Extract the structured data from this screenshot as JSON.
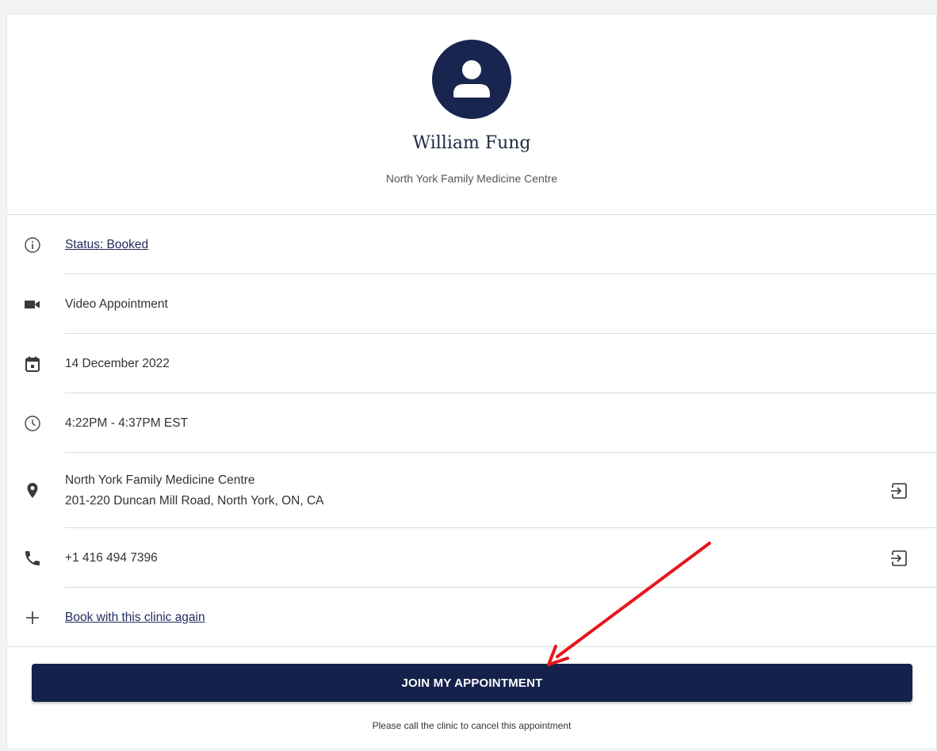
{
  "provider": {
    "name": "William Fung",
    "clinic": "North York Family Medicine Centre"
  },
  "details": {
    "status": {
      "label": "Status: Booked",
      "icon": "info-icon"
    },
    "type": {
      "label": "Video Appointment",
      "icon": "video-camera-icon"
    },
    "date": {
      "label": "14 December 2022",
      "icon": "calendar-icon"
    },
    "time": {
      "label": "4:22PM - 4:37PM EST",
      "icon": "clock-icon"
    },
    "location": {
      "line1": "North York Family Medicine Centre",
      "line2": "201-220 Duncan Mill Road, North York, ON, CA",
      "icon": "map-pin-icon",
      "action_icon": "open-external-icon"
    },
    "phone": {
      "label": "+1 416 494 7396",
      "icon": "phone-icon",
      "action_icon": "open-external-icon"
    },
    "book_again": {
      "label": "Book with this clinic again",
      "icon": "plus-icon"
    }
  },
  "join_button": {
    "label": "JOIN MY APPOINTMENT"
  },
  "cancel_note": "Please call the clinic to cancel this appointment",
  "colors": {
    "navy": "#17254f",
    "button": "#14214a",
    "link": "#1f2a5c",
    "annotation_arrow": "#e8141b"
  }
}
